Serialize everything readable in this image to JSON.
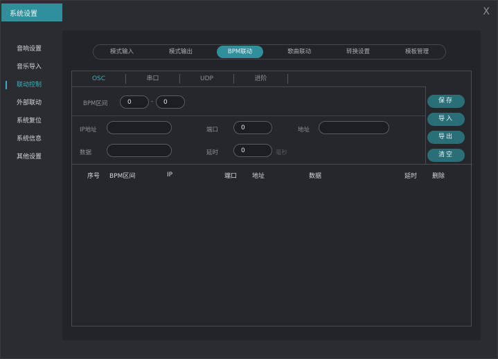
{
  "window": {
    "title": "系统设置",
    "close_label": "X"
  },
  "sidebar": {
    "items": [
      {
        "label": "音响设置",
        "active": false
      },
      {
        "label": "音乐导入",
        "active": false
      },
      {
        "label": "联动控制",
        "active": true
      },
      {
        "label": "外部联动",
        "active": false
      },
      {
        "label": "系统复位",
        "active": false
      },
      {
        "label": "系统信息",
        "active": false
      },
      {
        "label": "其他设置",
        "active": false
      }
    ]
  },
  "top_tabs": [
    {
      "label": "模式输入",
      "active": false
    },
    {
      "label": "模式输出",
      "active": false
    },
    {
      "label": "BPM联动",
      "active": true
    },
    {
      "label": "歌曲联动",
      "active": false
    },
    {
      "label": "转换设置",
      "active": false
    },
    {
      "label": "模板管理",
      "active": false
    }
  ],
  "sub_tabs": [
    {
      "label": "OSC",
      "active": true
    },
    {
      "label": "串口",
      "active": false
    },
    {
      "label": "UDP",
      "active": false
    },
    {
      "label": "进阶",
      "active": false
    }
  ],
  "form": {
    "bpm_label": "BPM区间",
    "bpm_from": "0",
    "bpm_sep": "-",
    "bpm_to": "0",
    "ip_label": "IP地址",
    "ip_value": "",
    "port_label": "端口",
    "port_value": "0",
    "address_label": "地址",
    "address_value": "",
    "data_label": "数据",
    "data_value": "",
    "delay_label": "延时",
    "delay_value": "0",
    "delay_unit": "毫秒"
  },
  "actions": {
    "save": "保存",
    "import": "导入",
    "export": "导出",
    "clear": "清空"
  },
  "table": {
    "columns": [
      "序号",
      "BPM区间",
      "IP",
      "端口",
      "地址",
      "数据",
      "延时",
      "删除"
    ],
    "rows": []
  },
  "colors": {
    "accent": "#2f8f9b",
    "accent_text": "#37b0c0",
    "background": "#2b2c30",
    "panel": "#232428"
  }
}
